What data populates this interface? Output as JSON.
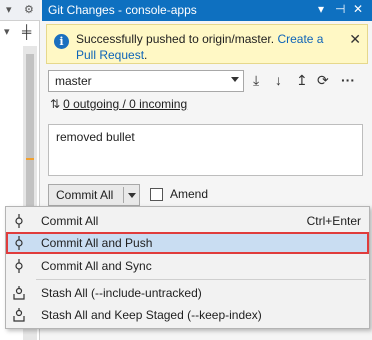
{
  "header": {
    "title": "Git Changes - console-apps"
  },
  "info": {
    "message": "Successfully pushed to origin/master.",
    "link": "Create a Pull Request",
    "link_suffix": "."
  },
  "branch": {
    "selected": "master"
  },
  "sync": {
    "status": "0 outgoing / 0 incoming"
  },
  "commit": {
    "message": "removed bullet",
    "button_label": "Commit All",
    "amend_label": "Amend"
  },
  "menu": {
    "items": [
      {
        "label": "Commit All",
        "shortcut": "Ctrl+Enter",
        "icon": "commit-icon"
      },
      {
        "label": "Commit All and Push",
        "shortcut": "",
        "icon": "commit-icon",
        "selected": true
      },
      {
        "label": "Commit All and Sync",
        "shortcut": "",
        "icon": "commit-icon"
      },
      {
        "label": "Stash All (--include-untracked)",
        "shortcut": "",
        "icon": "stash-icon"
      },
      {
        "label": "Stash All and Keep Staged (--keep-index)",
        "shortcut": "",
        "icon": "stash-icon"
      }
    ]
  },
  "colors": {
    "titlebar": "#0e70c0",
    "info_background": "#fff8c5",
    "selection_background": "#c9ddf2",
    "selection_border": "#e03c3c"
  }
}
